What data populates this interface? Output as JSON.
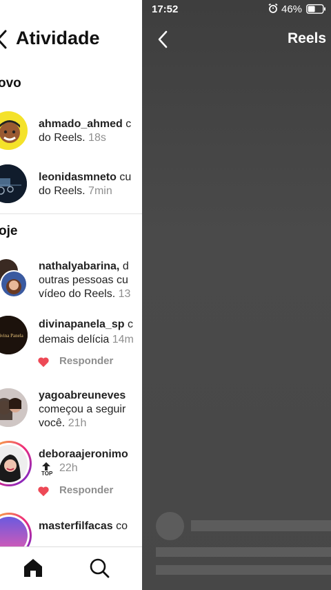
{
  "activity": {
    "title": "Atividade",
    "sections": {
      "new_label": "ovo",
      "today_label": "oje"
    },
    "items": [
      {
        "username": "ahmado_ahmed",
        "line1_rest": " c",
        "line2": "do Reels.",
        "time": "18s"
      },
      {
        "username": "leonidasmneto",
        "line1_rest": " cu",
        "line2": "do Reels.",
        "time": "7min"
      },
      {
        "username": "nathalyabarina,",
        "line1_rest": " d",
        "line2": "outras pessoas cu",
        "line3": "vídeo do Reels.",
        "time": "13"
      },
      {
        "username": "divinapanela_sp",
        "line1_rest": " c",
        "line2": "demais delícia",
        "time": "14m",
        "reply": "Responder"
      },
      {
        "username": "yagoabreuneves",
        "line2": "começou a seguir",
        "line3": "você.",
        "time": "21h"
      },
      {
        "username": "deboraajeronimo",
        "time": "22h",
        "top_badge": "TOP",
        "reply": "Responder"
      },
      {
        "username": "masterfilfacas",
        "line1_rest": " co"
      }
    ],
    "avatar_texts": {
      "divinapanela_logo": "Divina Panela"
    }
  },
  "status_bar": {
    "time": "17:52",
    "battery": "46%"
  },
  "reels": {
    "title": "Reels"
  },
  "colors": {
    "heart": "#ed4956",
    "story_ring": "#d6249f",
    "emoji_bg": "#f4e22a"
  },
  "icons": [
    "chevron-left-icon",
    "home-icon",
    "search-icon",
    "heart-icon",
    "alarm-icon",
    "battery-icon",
    "top-arrow-icon"
  ]
}
